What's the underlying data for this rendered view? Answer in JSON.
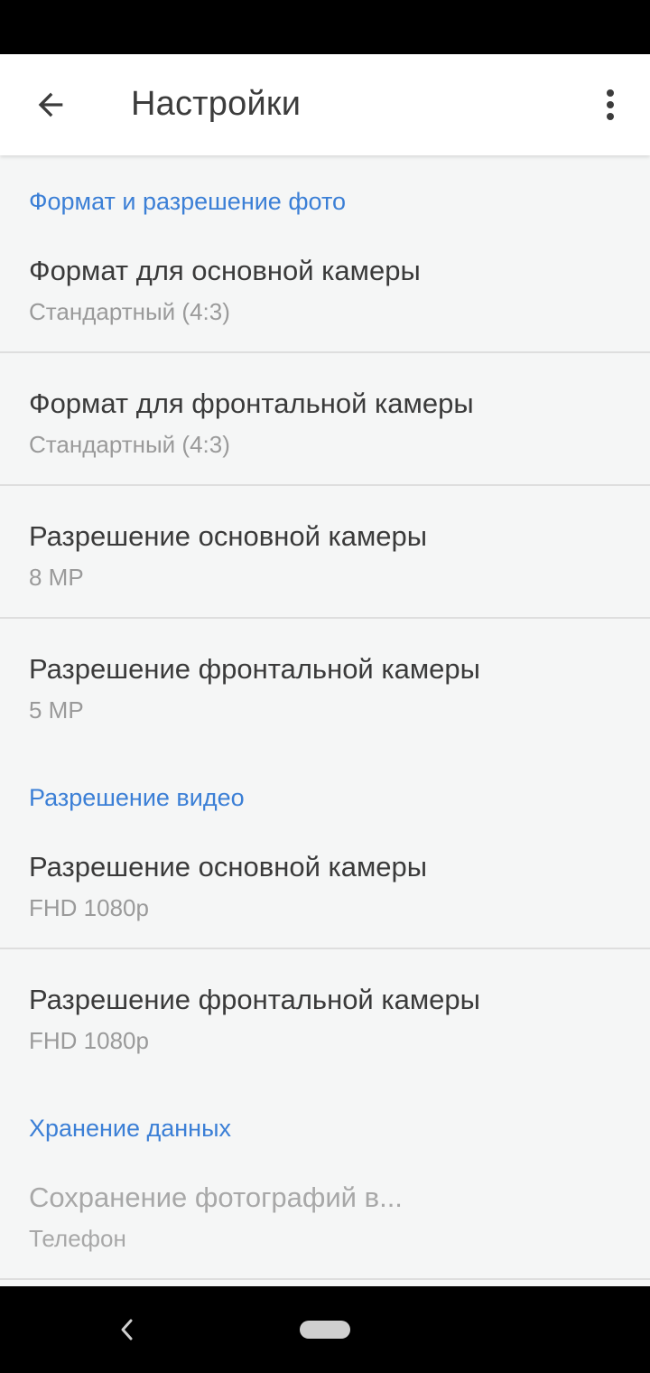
{
  "app_bar": {
    "title": "Настройки",
    "back_icon": "arrow-left-icon",
    "more_icon": "more-vert-icon"
  },
  "sections": {
    "photo": {
      "header": "Формат и разрешение фото",
      "items": [
        {
          "title": "Формат для основной камеры",
          "value": "Стандартный (4:3)"
        },
        {
          "title": "Формат для фронтальной камеры",
          "value": "Стандартный (4:3)"
        },
        {
          "title": "Разрешение основной камеры",
          "value": "8 MP"
        },
        {
          "title": "Разрешение фронтальной камеры",
          "value": "5 MP"
        }
      ]
    },
    "video": {
      "header": "Разрешение видео",
      "items": [
        {
          "title": "Разрешение основной камеры",
          "value": "FHD 1080p"
        },
        {
          "title": "Разрешение фронтальной камеры",
          "value": "FHD 1080p"
        }
      ]
    },
    "storage": {
      "header": "Хранение данных",
      "items": [
        {
          "title": "Сохранение фотографий в...",
          "value": "Телефон"
        }
      ]
    }
  },
  "colors": {
    "accent": "#3b7fd6",
    "primary_text": "#3a3a3a",
    "secondary_text": "#9a9a9a",
    "background": "#f5f6f6"
  }
}
